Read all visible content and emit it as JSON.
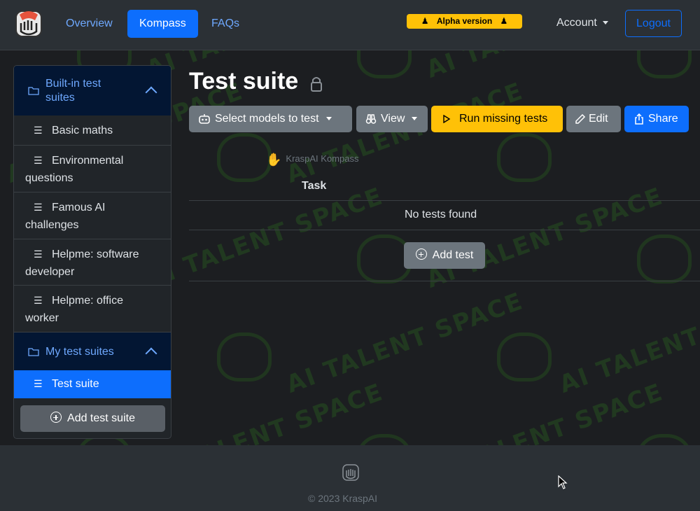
{
  "navbar": {
    "links": [
      {
        "label": "Overview"
      },
      {
        "label": "Kompass",
        "active": true
      },
      {
        "label": "FAQs"
      }
    ],
    "alpha_badge": "Alpha version",
    "account_label": "Account",
    "logout_label": "Logout"
  },
  "sidebar": {
    "builtin_header": "Built-in test suites",
    "builtin_items": [
      {
        "label": "Basic maths"
      },
      {
        "label": "Environmental questions"
      },
      {
        "label": "Famous AI challenges"
      },
      {
        "label": "Helpme: software developer"
      },
      {
        "label": "Helpme: office worker"
      }
    ],
    "my_header": "My test suites",
    "my_items": [
      {
        "label": "Test suite",
        "active": true
      }
    ],
    "add_suite_label": "Add test suite"
  },
  "main": {
    "title": "Test suite",
    "toolbar": {
      "select_models_label": "Select models to test",
      "view_label": "View",
      "run_missing_label": "Run missing tests",
      "edit_label": "Edit",
      "share_label": "Share"
    },
    "brand_mark": "KraspAI Kompass",
    "table_header": "Task",
    "empty_message": "No tests found",
    "add_test_label": "Add test"
  },
  "watermark_text": "AI TALENT SPACE",
  "footer": {
    "copyright": "© 2023 KraspAI"
  },
  "colors": {
    "primary": "#0d6efd",
    "warning": "#ffc107",
    "secondary": "#6c757d",
    "accordion_bg": "#031633"
  }
}
